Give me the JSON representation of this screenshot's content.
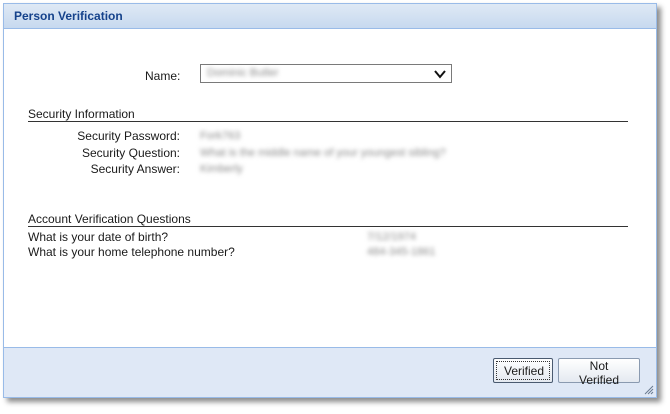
{
  "dialog": {
    "title": "Person Verification"
  },
  "name_field": {
    "label": "Name:",
    "value": "Dominic Butler"
  },
  "security": {
    "heading": "Security Information",
    "password_label": "Security Password:",
    "password_value": "Fork763",
    "question_label": "Security Question:",
    "question_value": "What is the middle name of your youngest sibling?",
    "answer_label": "Security Answer:",
    "answer_value": "Kimberly"
  },
  "account": {
    "heading": "Account Verification Questions",
    "q1_label": "What is your date of birth?",
    "q1_value": "7/12/1974",
    "q2_label": "What is your home telephone number?",
    "q2_value": "484-345-1861"
  },
  "footer": {
    "verified_label": "Verified",
    "not_verified_label": "Not Verified"
  },
  "colors": {
    "title_text": "#15428b",
    "border": "#99bbe8",
    "footer_bg": "#dfe8f6"
  }
}
